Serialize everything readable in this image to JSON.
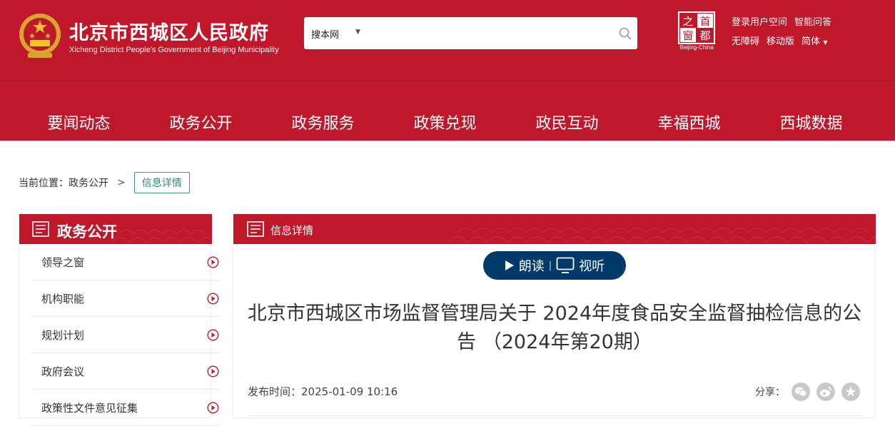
{
  "header": {
    "title": "北京市西城区人民政府",
    "subtitle": "Xicheng District People's Government of Beijing Municipality",
    "search": {
      "scope": "搜本网",
      "value": "",
      "placeholder": ""
    },
    "seal": {
      "caption": "Beijing-China",
      "chars": [
        "首",
        "都",
        "之",
        "窗"
      ]
    },
    "top_links": {
      "row1": [
        "登录用户空间",
        "智能问答"
      ],
      "row2": [
        "无障碍",
        "移动版",
        "简体"
      ]
    },
    "nav": [
      "要闻动态",
      "政务公开",
      "政务服务",
      "政策兑现",
      "政民互动",
      "幸福西城",
      "西城数据"
    ],
    "colors": {
      "brand_red": "#c0182b",
      "reader_blue": "#003a6b",
      "crumb_green": "#2f8e6e"
    }
  },
  "breadcrumb": {
    "prefix": "当前位置：",
    "parent": "政务公开",
    "separator": ">",
    "current": "信息详情"
  },
  "sidebar": {
    "title": "政务公开",
    "items": [
      "领导之窗",
      "机构职能",
      "规划计划",
      "政府会议",
      "政策性文件意见征集"
    ]
  },
  "main": {
    "panel_title": "信息详情",
    "reader": {
      "read_label": "朗读",
      "view_label": "视听",
      "separator": "|"
    },
    "article_title": "北京市西城区市场监督管理局关于 2024年度食品安全监督抽检信息的公告 （2024年第20期）",
    "publish_label": "发布时间：",
    "publish_time": "2025-01-09 10:16",
    "share_label": "分享：",
    "share_icons": [
      "wechat-icon",
      "weibo-icon",
      "favorite-icon"
    ]
  }
}
